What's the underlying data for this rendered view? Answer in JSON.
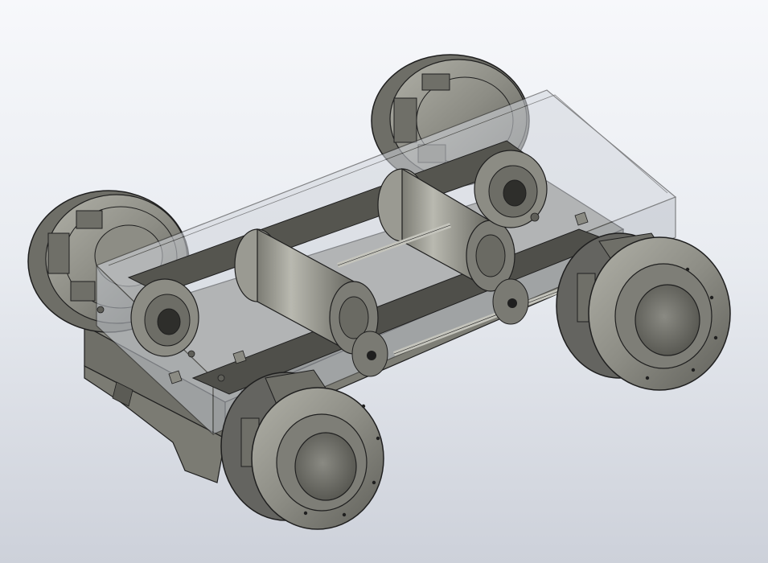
{
  "scene": {
    "subject": "cad-model",
    "colors": {
      "background_top": "#f7f8fb",
      "background_bottom": "#cdd1da",
      "metal_light": "#a7a79e",
      "metal_mid": "#8a8a82",
      "metal_dark": "#5a5a55",
      "edge": "#1f1f1f",
      "glass": "#c9ced6"
    }
  }
}
